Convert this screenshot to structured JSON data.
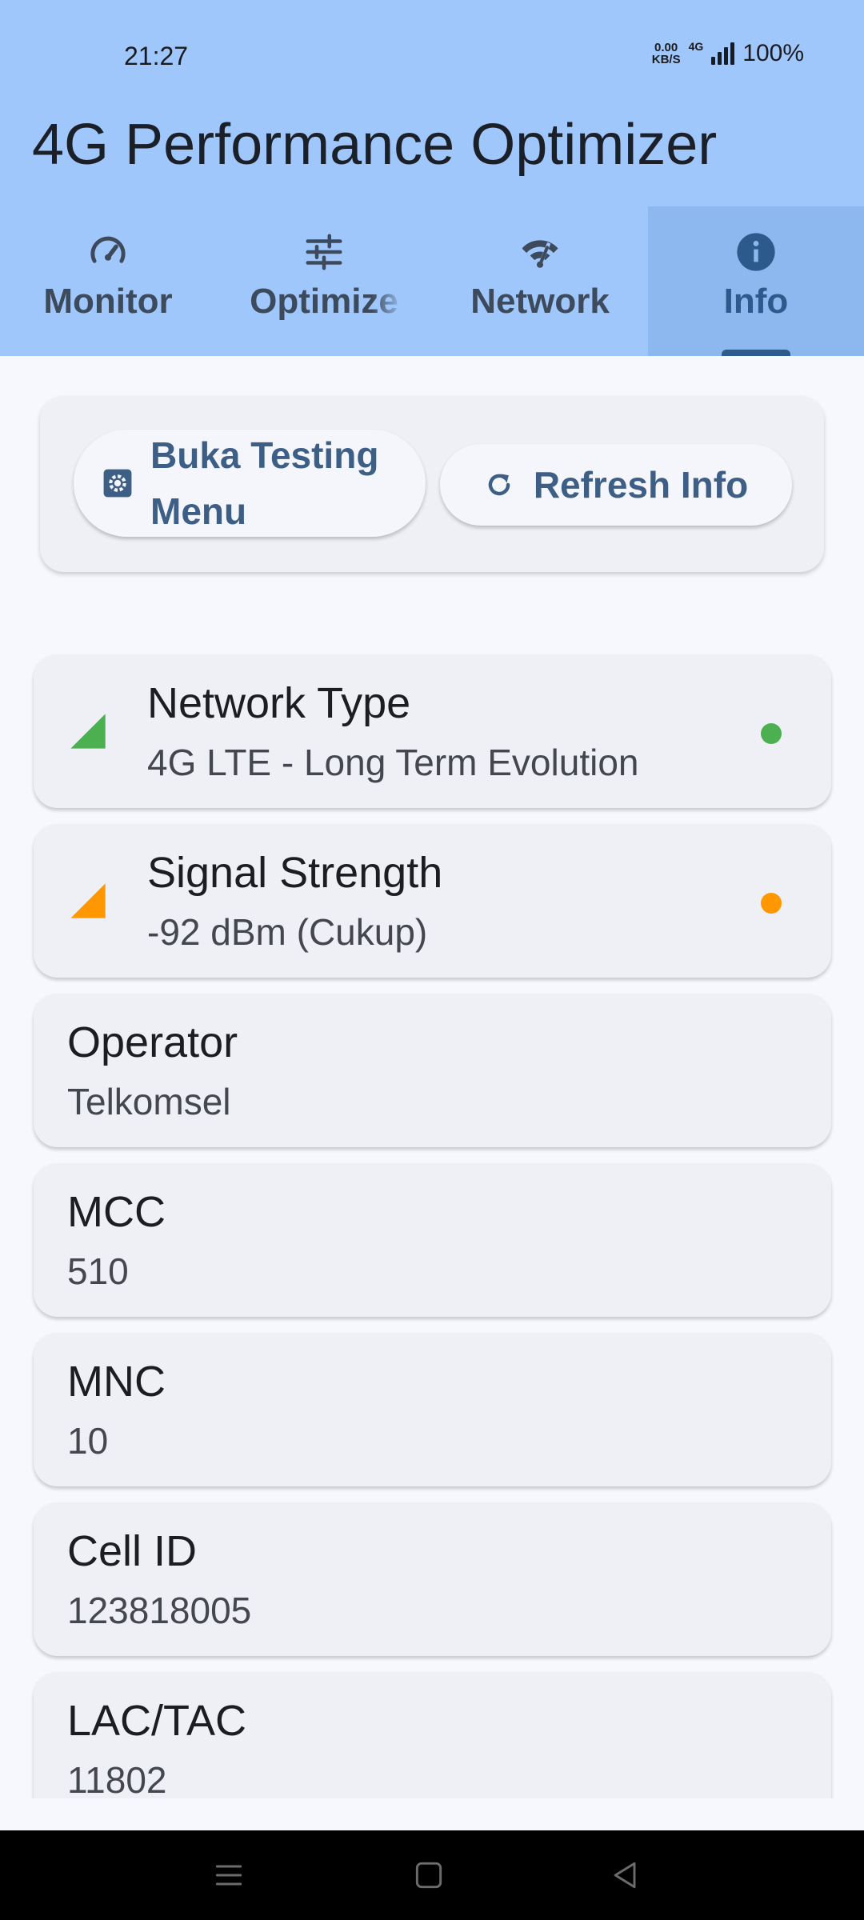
{
  "status_bar": {
    "time": "21:27",
    "net_speed_value": "0.00",
    "net_speed_unit": "KB/S",
    "network_badge": "4G",
    "battery": "100%"
  },
  "app": {
    "title": "4G Performance Optimizer"
  },
  "tabs": [
    {
      "label": "Monitor",
      "icon": "gauge-icon",
      "active": false
    },
    {
      "label": "Optimize",
      "icon": "sliders-icon",
      "active": false
    },
    {
      "label": "Network",
      "icon": "wifi-signal-icon",
      "active": false
    },
    {
      "label": "Info",
      "icon": "info-icon",
      "active": true
    }
  ],
  "actions": {
    "testing_menu_line1": "Buka Testing",
    "testing_menu_line2": "Menu",
    "refresh_label": "Refresh Info"
  },
  "info": {
    "network_type": {
      "title": "Network Type",
      "value": "4G LTE - Long Term Evolution",
      "status_color": "#4caf50"
    },
    "signal_strength": {
      "title": "Signal Strength",
      "value": "-92 dBm (Cukup)",
      "status_color": "#ff9800"
    },
    "operator": {
      "title": "Operator",
      "value": "Telkomsel"
    },
    "mcc": {
      "title": "MCC",
      "value": "510"
    },
    "mnc": {
      "title": "MNC",
      "value": "10"
    },
    "cell_id": {
      "title": "Cell ID",
      "value": "123818005"
    },
    "lac_tac": {
      "title": "LAC/TAC",
      "value": "11802"
    }
  },
  "colors": {
    "header": "#9fc7fb",
    "active_tab": "#8cb8ef",
    "accent": "#2d5b8c",
    "good": "#4caf50",
    "fair": "#ff9800"
  }
}
